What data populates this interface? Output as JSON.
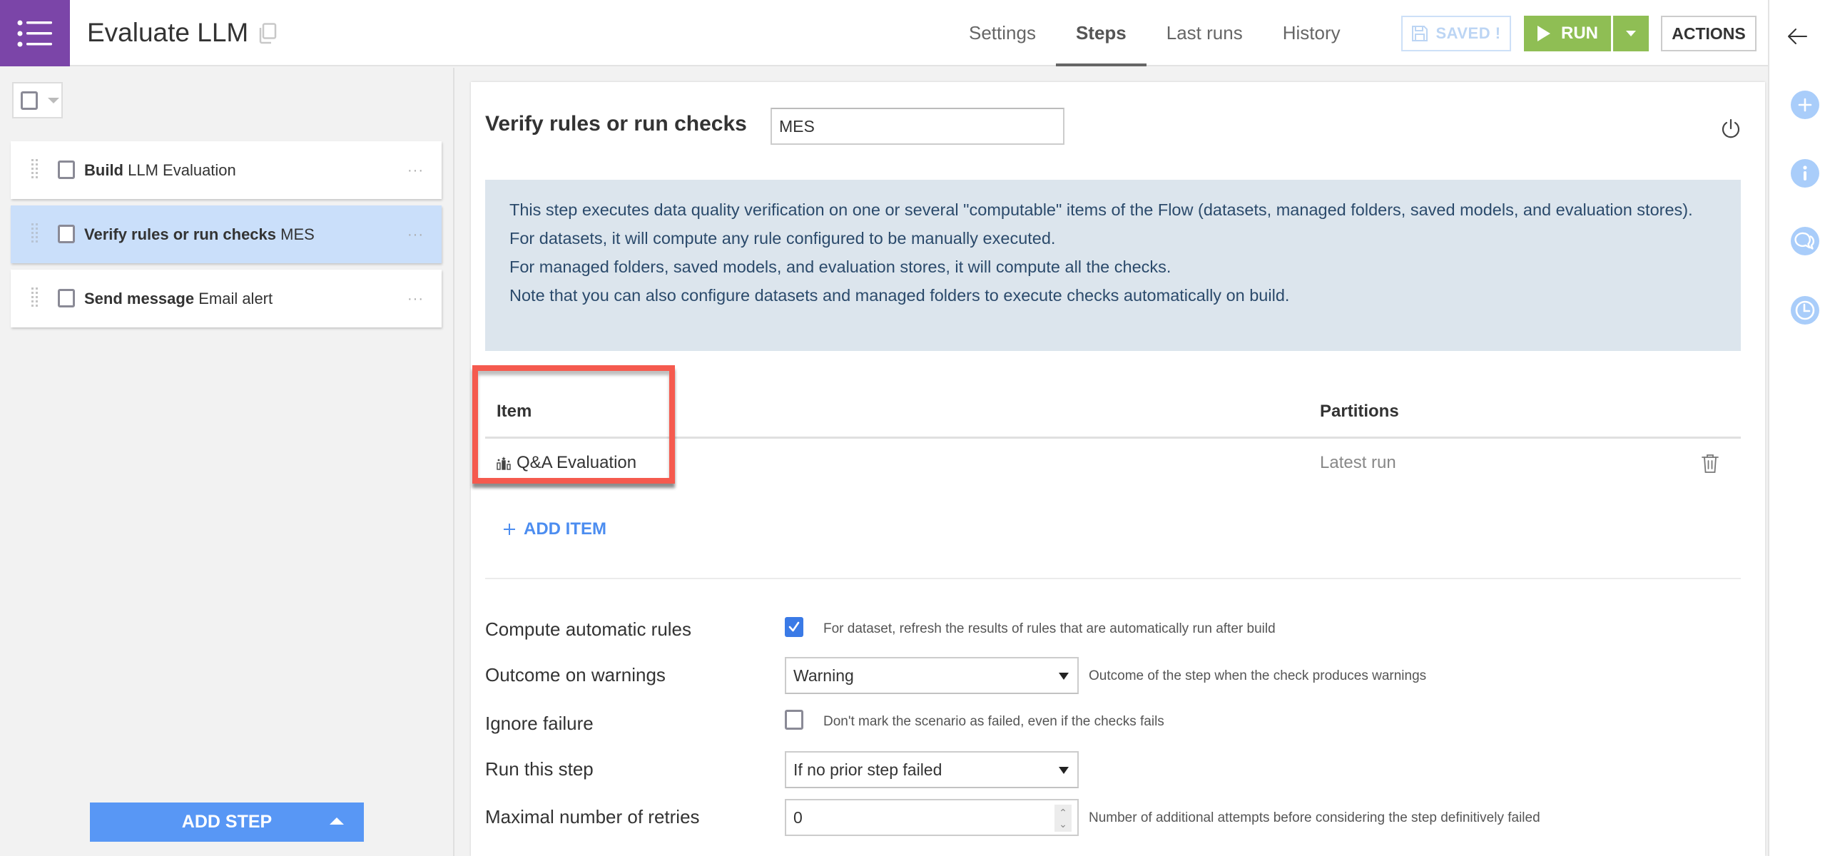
{
  "app": {
    "title": "Evaluate LLM",
    "icons": {
      "menu": "list-menu-icon",
      "copy": "copy-icon"
    }
  },
  "header": {
    "tabs": [
      {
        "label": "Settings",
        "active": false
      },
      {
        "label": "Steps",
        "active": true
      },
      {
        "label": "Last runs",
        "active": false
      },
      {
        "label": "History",
        "active": false
      }
    ],
    "saved_label": "SAVED !",
    "run_label": "RUN",
    "actions_label": "ACTIONS"
  },
  "left_panel": {
    "steps": [
      {
        "type": "Build",
        "name": "LLM Evaluation",
        "selected": false
      },
      {
        "type": "Verify rules or run checks",
        "name": "MES",
        "selected": true
      },
      {
        "type": "Send message",
        "name": "Email alert",
        "selected": false
      }
    ],
    "more_label": "···",
    "add_step_label": "ADD STEP"
  },
  "step_editor": {
    "title": "Verify rules or run checks",
    "name_value": "MES",
    "info_lines": [
      "This step executes data quality verification on one or several \"computable\" items of the Flow (datasets, managed folders, saved models, and evaluation stores).",
      "For datasets, it will compute any rule configured to be manually executed.",
      "For managed folders, saved models, and evaluation stores, it will compute all the checks.",
      "Note that you can also configure datasets and managed folders to execute checks automatically on build."
    ],
    "items_table": {
      "headers": {
        "item": "Item",
        "partitions": "Partitions"
      },
      "rows": [
        {
          "item": "Q&A Evaluation",
          "item_icon": "evaluation-store-icon",
          "partitions": "Latest run"
        }
      ]
    },
    "add_item_label": "ADD ITEM",
    "settings": {
      "compute_automatic_rules": {
        "label": "Compute automatic rules",
        "checked": true,
        "help": "For dataset, refresh the results of rules that are automatically run after build"
      },
      "outcome_on_warnings": {
        "label": "Outcome on warnings",
        "value": "Warning",
        "help": "Outcome of the step when the check produces warnings"
      },
      "ignore_failure": {
        "label": "Ignore failure",
        "checked": false,
        "help": "Don't mark the scenario as failed, even if the checks fails"
      },
      "run_this_step": {
        "label": "Run this step",
        "value": "If no prior step failed"
      },
      "max_retries": {
        "label": "Maximal number of retries",
        "value": "0",
        "help": "Number of additional attempts before considering the step definitively failed"
      }
    }
  },
  "colors": {
    "brand_purple": "#7b45a8",
    "run_green": "#8fbe54",
    "primary_blue": "#5897f5",
    "selected_step": "#cadffa",
    "info_bg": "#dce5ed",
    "highlight_red": "#f55a4e"
  }
}
